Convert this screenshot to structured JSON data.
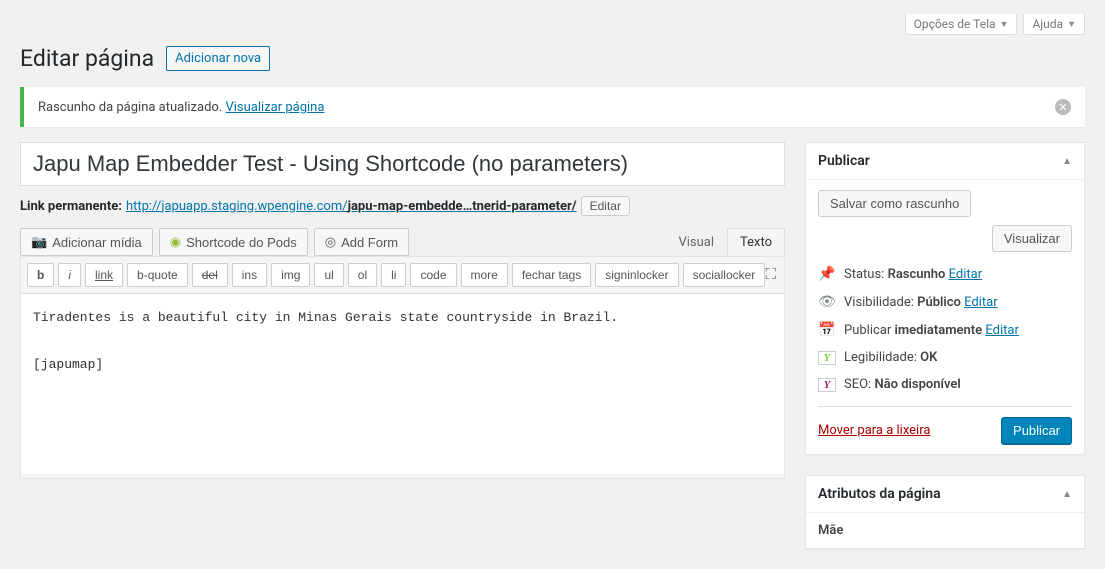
{
  "top": {
    "screen_options": "Opções de Tela",
    "help": "Ajuda"
  },
  "header": {
    "title": "Editar página",
    "add_new": "Adicionar nova"
  },
  "notice": {
    "text": "Rascunho da página atualizado. ",
    "link": "Visualizar página"
  },
  "post": {
    "title": "Japu Map Embedder Test - Using Shortcode (no parameters)",
    "permalink_label": "Link permanente:",
    "permalink_base": "http://japuapp.staging.wpengine.com/",
    "permalink_slug": "japu-map-embedde…tnerid-parameter/",
    "edit_btn": "Editar",
    "content": "Tiradentes is a beautiful city in Minas Gerais state countryside in Brazil.\n\n[japumap]"
  },
  "media": {
    "add_media": "Adicionar mídia",
    "pods": "Shortcode do Pods",
    "add_form": "Add Form"
  },
  "editor_tabs": {
    "visual": "Visual",
    "text": "Texto"
  },
  "toolbar": [
    "b",
    "i",
    "link",
    "b-quote",
    "del",
    "ins",
    "img",
    "ul",
    "ol",
    "li",
    "code",
    "more",
    "fechar tags",
    "signinlocker",
    "sociallocker"
  ],
  "publish": {
    "title": "Publicar",
    "save_draft": "Salvar como rascunho",
    "preview": "Visualizar",
    "status_label": "Status:",
    "status_value": "Rascunho",
    "status_edit": "Editar",
    "visibility_label": "Visibilidade:",
    "visibility_value": "Público",
    "visibility_edit": "Editar",
    "schedule_label": "Publicar",
    "schedule_value": "imediatamente",
    "schedule_edit": "Editar",
    "readability_label": "Legibilidade:",
    "readability_value": "OK",
    "seo_label": "SEO:",
    "seo_value": "Não disponível",
    "trash": "Mover para a lixeira",
    "publish_btn": "Publicar"
  },
  "attributes": {
    "title": "Atributos da página",
    "parent_label": "Mãe"
  }
}
